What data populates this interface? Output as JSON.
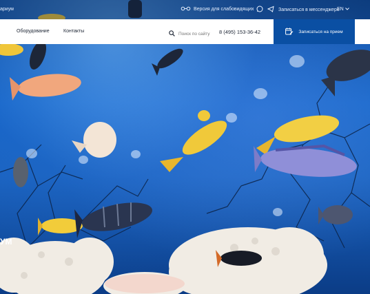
{
  "topbar": {
    "breadcrumb_fragment": "ариум",
    "vision_label": "Версия для слабовидящих",
    "messenger_label": "Записаться в мессенджере",
    "language": "EN"
  },
  "navbar": {
    "links": [
      "Оборудование",
      "Контакты"
    ],
    "search_placeholder": "Поиск по сайту",
    "phone": "8 (495) 153-36-42",
    "cta_label": "Записаться на прием"
  },
  "hero": {
    "title_fragment": "УМ"
  },
  "icons": [
    "glasses-icon",
    "whatsapp-icon",
    "telegram-icon",
    "chevron-down-icon",
    "search-icon",
    "calendar-edit-icon"
  ],
  "colors": {
    "navbar_bg": "#ffffff",
    "cta_bg": "#0a4fa3",
    "water": "#1565c8",
    "coral": "#f3efe8"
  }
}
